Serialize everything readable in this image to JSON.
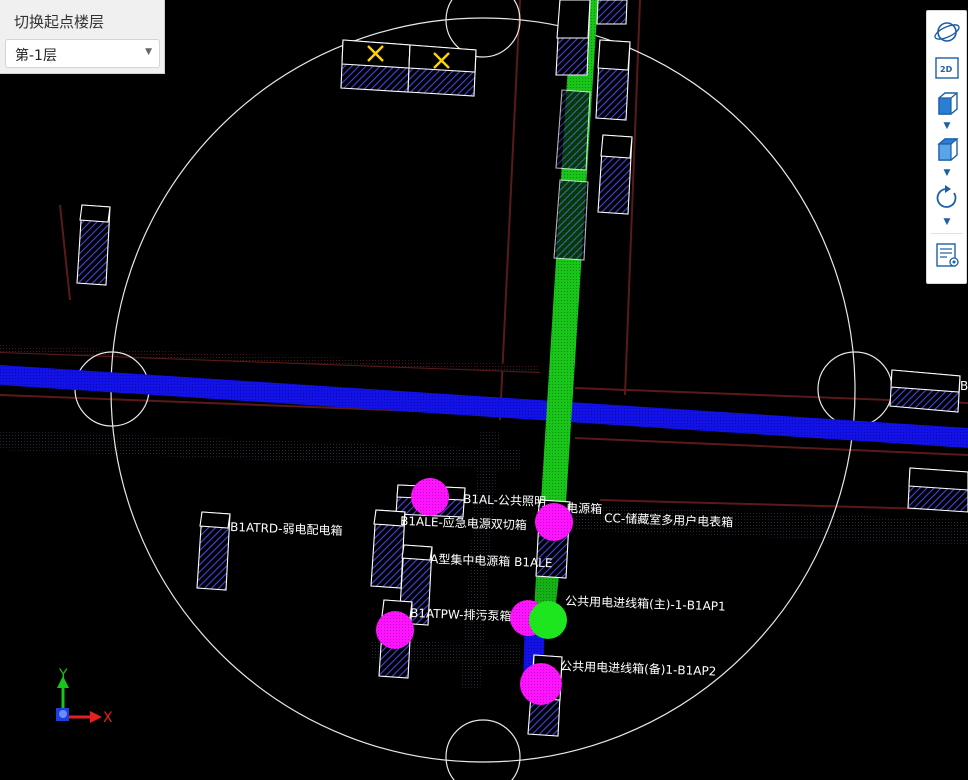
{
  "floor_panel": {
    "title": "切换起点楼层",
    "selected_floor": "第-1层"
  },
  "toolbar": {
    "buttons": [
      {
        "icon": "orbit-icon"
      },
      {
        "icon": "view-2d-icon",
        "label": "2D"
      },
      {
        "icon": "cube-view-icon"
      },
      {
        "icon": "cube-view-alt-icon"
      },
      {
        "icon": "rotate-icon"
      },
      {
        "icon": "properties-view-icon"
      }
    ]
  },
  "scene": {
    "labels": {
      "b1atrd": "B1ATRD-弱电配电箱",
      "b1al": "B1AL-公共照明",
      "b1ale": "B1ALE-应急电源双切箱",
      "box_a": "A型集中电源箱 B1ALE",
      "b1atpw": "B1ATPW-排污泵箱",
      "cc": "CC-储藏室多用户电表箱",
      "dianxiang": "电源箱",
      "ap1": "公共用电进线箱(主)-1-B1AP1",
      "ap2": "公共用电进线箱(备)1-B1AP2",
      "right_b": "B"
    },
    "axis": {
      "x": "X",
      "y": "Y"
    },
    "colors": {
      "pipe_green": "#19c519",
      "pipe_blue": "#1010e6",
      "node_magenta": "#ff00ff",
      "node_green": "#1ee61e",
      "box_outline": "#ffffff",
      "hatch": "#3a3ad8",
      "marker_yellow": "#ffd400"
    }
  }
}
